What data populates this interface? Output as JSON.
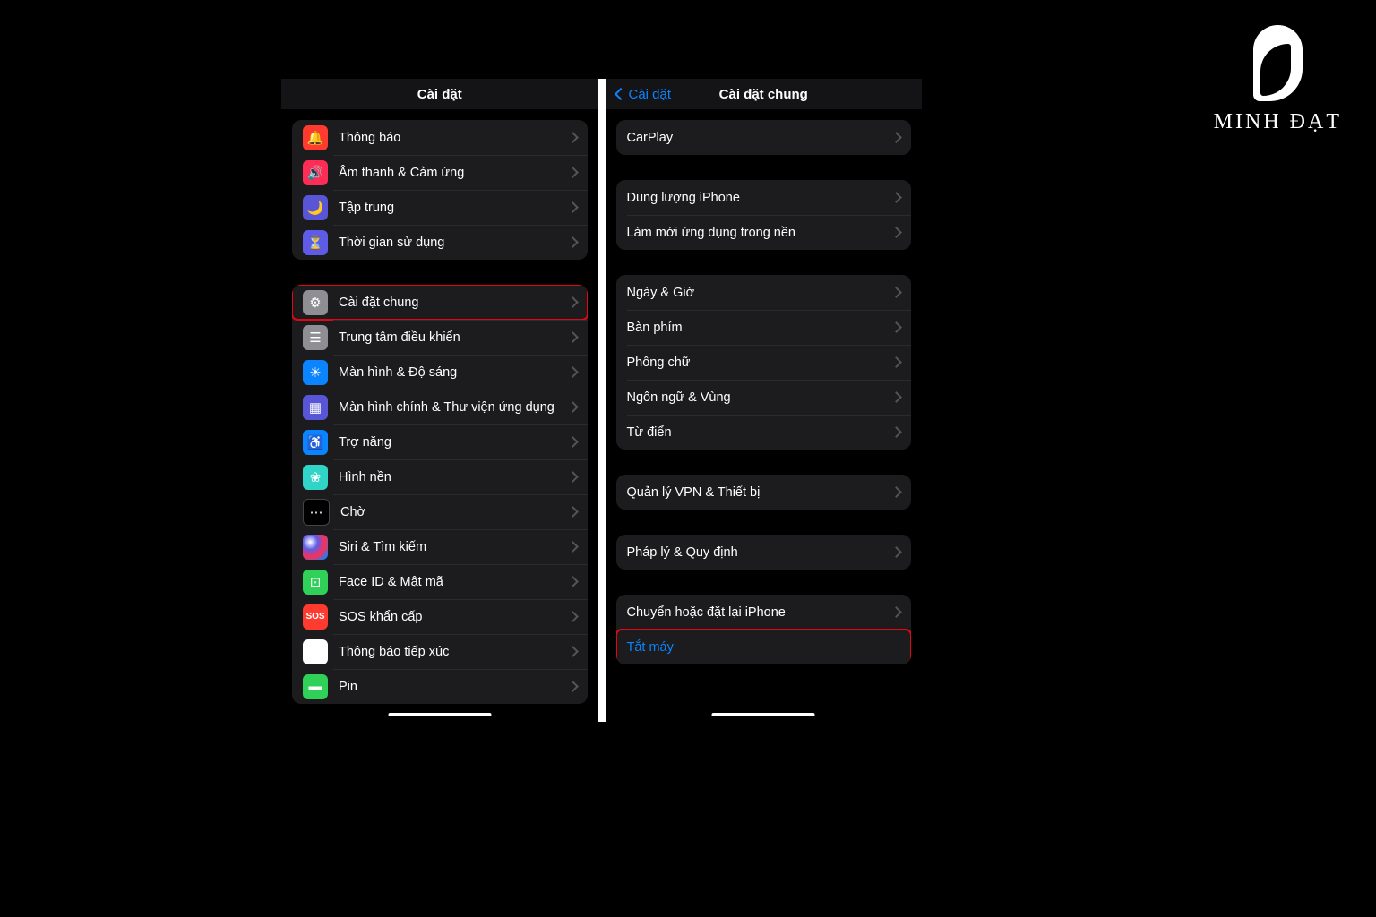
{
  "watermark": "MINH ĐẠT",
  "left": {
    "title": "Cài đặt",
    "groups": [
      {
        "icons": true,
        "cells": [
          {
            "name": "notifications",
            "iconClass": "i-bell",
            "glyph": "🔔",
            "label": "Thông báo"
          },
          {
            "name": "sounds",
            "iconClass": "i-snd",
            "glyph": "🔊",
            "label": "Âm thanh & Cảm ứng"
          },
          {
            "name": "focus",
            "iconClass": "i-moon",
            "glyph": "🌙",
            "label": "Tập trung"
          },
          {
            "name": "screentime",
            "iconClass": "i-time",
            "glyph": "⏳",
            "label": "Thời gian sử dụng"
          }
        ]
      },
      {
        "icons": true,
        "cells": [
          {
            "name": "general",
            "iconClass": "i-gear",
            "glyph": "⚙",
            "label": "Cài đặt chung",
            "highlight": true
          },
          {
            "name": "control-center",
            "iconClass": "i-cc",
            "glyph": "☰",
            "label": "Trung tâm điều khiển"
          },
          {
            "name": "display",
            "iconClass": "i-disp",
            "glyph": "☀",
            "label": "Màn hình & Độ sáng"
          },
          {
            "name": "home-screen",
            "iconClass": "i-home",
            "glyph": "▦",
            "label": "Màn hình chính & Thư viện ứng dụng"
          },
          {
            "name": "accessibility",
            "iconClass": "i-acc",
            "glyph": "♿",
            "label": "Trợ năng"
          },
          {
            "name": "wallpaper",
            "iconClass": "i-wall",
            "glyph": "❀",
            "label": "Hình nền"
          },
          {
            "name": "standby",
            "iconClass": "i-wait",
            "glyph": "⋯",
            "label": "Chờ"
          },
          {
            "name": "siri",
            "iconClass": "i-siri",
            "glyph": "",
            "label": "Siri & Tìm kiếm"
          },
          {
            "name": "faceid",
            "iconClass": "i-face",
            "glyph": "⊡",
            "label": "Face ID & Mật mã"
          },
          {
            "name": "sos",
            "iconClass": "i-sos",
            "glyph": "SOS",
            "label": "SOS khẩn cấp"
          },
          {
            "name": "exposure",
            "iconClass": "i-expo",
            "glyph": "",
            "label": "Thông báo tiếp xúc"
          },
          {
            "name": "battery",
            "iconClass": "i-bat",
            "glyph": "▬",
            "label": "Pin"
          }
        ]
      }
    ]
  },
  "right": {
    "back": "Cài đặt",
    "title": "Cài đặt chung",
    "groups": [
      {
        "cells": [
          {
            "name": "carplay",
            "label": "CarPlay"
          }
        ]
      },
      {
        "cells": [
          {
            "name": "storage",
            "label": "Dung lượng iPhone"
          },
          {
            "name": "background-refresh",
            "label": "Làm mới ứng dụng trong nền"
          }
        ]
      },
      {
        "cells": [
          {
            "name": "date-time",
            "label": "Ngày & Giờ"
          },
          {
            "name": "keyboard",
            "label": "Bàn phím"
          },
          {
            "name": "fonts",
            "label": "Phông chữ"
          },
          {
            "name": "language-region",
            "label": "Ngôn ngữ & Vùng"
          },
          {
            "name": "dictionary",
            "label": "Từ điển"
          }
        ]
      },
      {
        "cells": [
          {
            "name": "vpn-device",
            "label": "Quản lý VPN & Thiết bị"
          }
        ]
      },
      {
        "cells": [
          {
            "name": "legal",
            "label": "Pháp lý & Quy định"
          }
        ]
      },
      {
        "cells": [
          {
            "name": "transfer-reset",
            "label": "Chuyển hoặc đặt lại iPhone"
          },
          {
            "name": "shutdown",
            "label": "Tắt máy",
            "accent": true,
            "highlight": true,
            "noChev": true
          }
        ]
      }
    ]
  }
}
